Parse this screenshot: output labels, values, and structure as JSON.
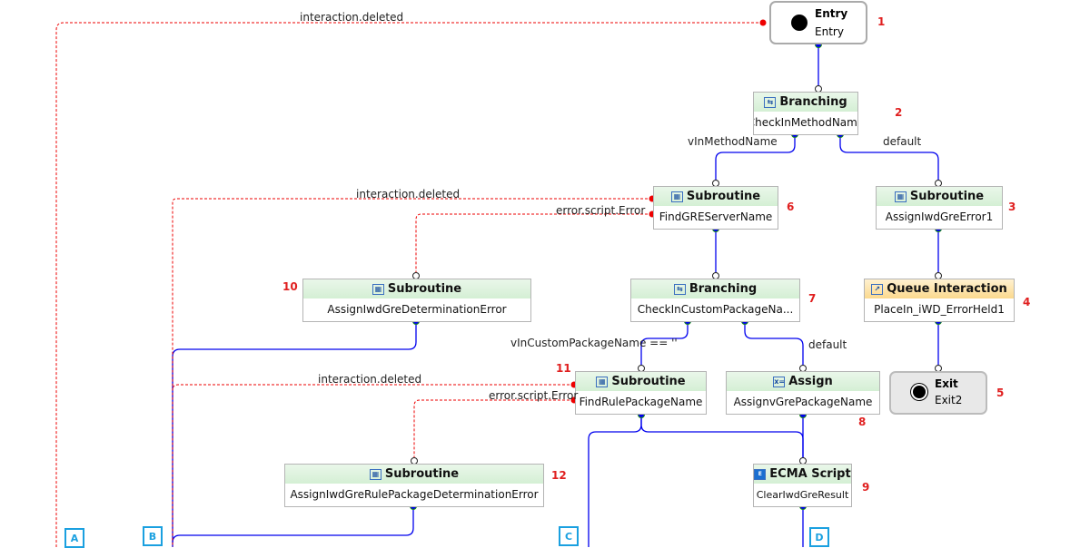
{
  "nodes": [
    {
      "id": "1",
      "type": "Entry",
      "name": "Entry"
    },
    {
      "id": "2",
      "type": "Branching",
      "name": "CheckInMethodName"
    },
    {
      "id": "3",
      "type": "Subroutine",
      "name": "AssignIwdGreError1"
    },
    {
      "id": "4",
      "type": "Queue Interaction",
      "name": "PlaceIn_iWD_ErrorHeld1"
    },
    {
      "id": "5",
      "type": "Exit",
      "name": "Exit2"
    },
    {
      "id": "6",
      "type": "Subroutine",
      "name": "FindGREServerName"
    },
    {
      "id": "7",
      "type": "Branching",
      "name": "CheckInCustomPackageNa..."
    },
    {
      "id": "8",
      "type": "Assign",
      "name": "AssignvGrePackageName"
    },
    {
      "id": "9",
      "type": "ECMA Script",
      "name": "ClearIwdGreResult"
    },
    {
      "id": "10",
      "type": "Subroutine",
      "name": "AssignIwdGreDeterminationError"
    },
    {
      "id": "11",
      "type": "Subroutine",
      "name": "FindRulePackageName"
    },
    {
      "id": "12",
      "type": "Subroutine",
      "name": "AssignIwdGreRulePackageDeterminationError"
    }
  ],
  "edge_labels": {
    "entry_deleted": "interaction.deleted",
    "vin": "vInMethodName",
    "default1": "default",
    "find_deleted": "interaction.deleted",
    "find_error": "error.script.Error",
    "vincustom": "vInCustomPackageName == ''",
    "default2": "default",
    "rule_deleted": "interaction.deleted",
    "rule_error": "error.script.Error"
  },
  "connectors": [
    "A",
    "B",
    "C",
    "D"
  ],
  "colors": {
    "flow": "#0000ee",
    "error": "#ee0000",
    "number": "#e02020",
    "connector": "#1aa0e0"
  }
}
